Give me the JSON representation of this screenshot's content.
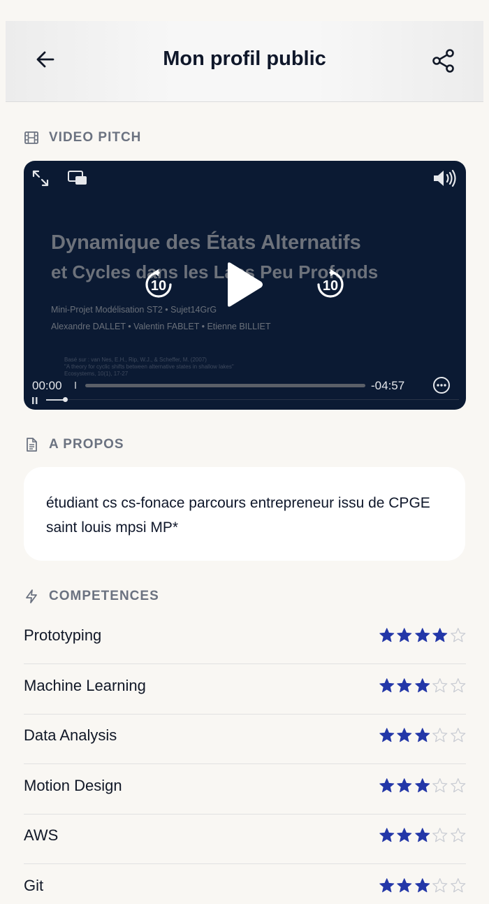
{
  "header": {
    "title": "Mon profil public",
    "back_icon": "arrow-left-icon",
    "share_icon": "share-icon"
  },
  "video_section": {
    "label": "VIDEO PITCH",
    "icon": "film-icon"
  },
  "video": {
    "slide_title_line1": "Dynamique des États Alternatifs",
    "slide_title_line2": "et Cycles dans les Lacs Peu Profonds",
    "slide_subtitle": "Mini-Projet Modélisation ST2 • Sujet14GrG",
    "slide_authors": "Alexandre DALLET • Valentin FABLET • Etienne BILLIET",
    "slide_reference": [
      "Basé sur : van Nes, E.H., Rip, W.J., & Scheffer, M. (2007)",
      "\"A theory for cyclic shifts between alternative states in shallow lakes\"",
      "Ecosystems, 10(1), 17-27"
    ],
    "rewind_label": "10",
    "forward_label": "10",
    "current_time": "00:00",
    "remaining_time": "-04:57",
    "progress": 0.0,
    "icons": {
      "fullscreen": "expand-icon",
      "pip": "picture-in-picture-icon",
      "volume": "volume-icon",
      "play": "play-icon",
      "rewind": "rewind-10-icon",
      "forward": "forward-10-icon",
      "more": "more-icon",
      "pause": "pause-icon"
    }
  },
  "about_section": {
    "label": "A PROPOS",
    "icon": "document-icon",
    "text": "étudiant cs cs-fonace parcours entrepreneur issu de CPGE saint louis mpsi MP*"
  },
  "skills_section": {
    "label": "COMPETENCES",
    "icon": "lightning-icon",
    "max_rating": 5,
    "items": [
      {
        "name": "Prototyping",
        "rating": 4
      },
      {
        "name": "Machine Learning",
        "rating": 3
      },
      {
        "name": "Data Analysis",
        "rating": 3
      },
      {
        "name": "Motion Design",
        "rating": 3
      },
      {
        "name": "AWS",
        "rating": 3
      },
      {
        "name": "Git",
        "rating": 3
      }
    ]
  },
  "colors": {
    "background": "#f9f7f3",
    "star_filled": "#2337a8",
    "star_empty": "#c9ccd3",
    "video_background": "#0b1a33",
    "section_label": "#6b7280"
  }
}
